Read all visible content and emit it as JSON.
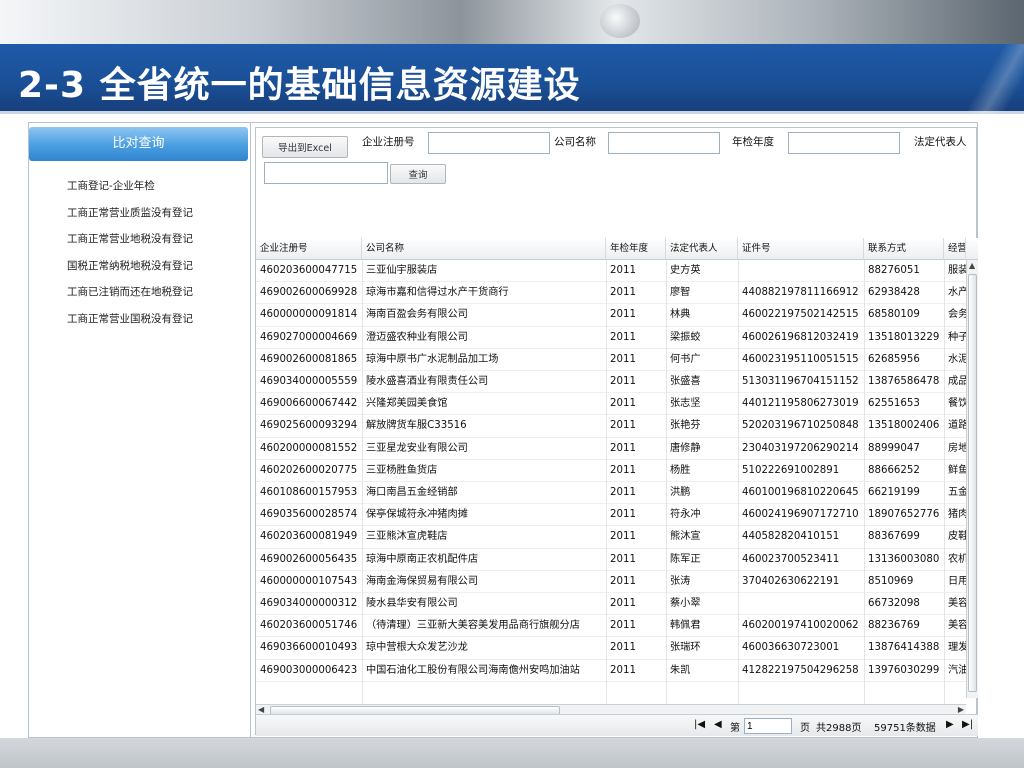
{
  "slide": {
    "title": "2-3  全省统一的基础信息资源建设"
  },
  "left_panel": {
    "header": "比对查询",
    "items": [
      "工商登记-企业年检",
      "工商正常营业质监没有登记",
      "工商正常营业地税没有登记",
      "国税正常纳税地税没有登记",
      "工商已注销而还在地税登记",
      "工商正常营业国税没有登记"
    ]
  },
  "toolbar": {
    "export_label": "导出到Excel",
    "search_label": "查询",
    "fields": {
      "reg_no": {
        "label": "企业注册号",
        "value": ""
      },
      "company": {
        "label": "公司名称",
        "value": ""
      },
      "year": {
        "label": "年检年度",
        "value": ""
      },
      "legal_rep": {
        "label": "法定代表人",
        "value": ""
      }
    }
  },
  "grid": {
    "columns": [
      "企业注册号",
      "公司名称",
      "年检年度",
      "法定代表人",
      "证件号",
      "联系方式",
      "经营"
    ],
    "rows": [
      [
        "460203600047715",
        "三亚仙宇服装店",
        "2011",
        "史方英",
        "",
        "88276051",
        "服装"
      ],
      [
        "469002600069928",
        "琼海市嘉和信得过水产干货商行",
        "2011",
        "廖智",
        "440882197811166912",
        "62938428",
        "水产"
      ],
      [
        "460000000091814",
        "海南百盈会务有限公司",
        "2011",
        "林典",
        "460022197502142515",
        "68580109",
        "会务"
      ],
      [
        "469027000004669",
        "澄迈盛农种业有限公司",
        "2011",
        "梁振蛟",
        "460026196812032419",
        "13518013229",
        "种子"
      ],
      [
        "469002600081865",
        "琼海中原书广水泥制品加工场",
        "2011",
        "何书广",
        "460023195110051515",
        "62685956",
        "水泥"
      ],
      [
        "469034000005559",
        "陵水盛喜酒业有限责任公司",
        "2011",
        "张盛喜",
        "513031196704151152",
        "13876586478",
        "成品"
      ],
      [
        "469006600067442",
        "兴隆郑美园美食馆",
        "2011",
        "张志坚",
        "440121195806273019",
        "62551653",
        "餐饮"
      ],
      [
        "469025600093294",
        "解放牌货车服C33516",
        "2011",
        "张艳芬",
        "520203196710250848",
        "13518002406",
        "道路"
      ],
      [
        "460200000081552",
        "三亚星龙安业有限公司",
        "2011",
        "唐修静",
        "230403197206290214",
        "88999047",
        "房地"
      ],
      [
        "460202600020775",
        "三亚杨胜鱼货店",
        "2011",
        "杨胜",
        "510222691002891",
        "88666252",
        "鲜鱼"
      ],
      [
        "460108600157953",
        "海口南昌五金经销部",
        "2011",
        "洪鹏",
        "460100196810220645",
        "66219199",
        "五金"
      ],
      [
        "469035600028574",
        "保亭保城符永冲猪肉摊",
        "2011",
        "符永冲",
        "460024196907172710",
        "18907652776",
        "猪肉"
      ],
      [
        "460203600081949",
        "三亚熊沐宣虎鞋店",
        "2011",
        "熊沐宣",
        "440582820410151",
        "88367699",
        "皮鞋"
      ],
      [
        "469002600056435",
        "琼海中原南正农机配件店",
        "2011",
        "陈军正",
        "460023700523411",
        "13136003080",
        "农机"
      ],
      [
        "460000000107543",
        "海南金海保贸易有限公司",
        "2011",
        "张涛",
        "370402630622191",
        "8510969",
        "日用"
      ],
      [
        "469034000000312",
        "陵水县华安有限公司",
        "2011",
        "蔡小翠",
        "",
        "66732098",
        "美容"
      ],
      [
        "460203600051746",
        "（待清理）三亚新大美容美发用品商行旗舰分店",
        "2011",
        "韩佩君",
        "460200197410020062",
        "88236769",
        "美容"
      ],
      [
        "469036600010493",
        "琼中营根大众发艺沙龙",
        "2011",
        "张瑞环",
        "460036630723001",
        "13876414388",
        "理发"
      ],
      [
        "469003000006423",
        "中国石油化工股份有限公司海南儋州安鸣加油站",
        "2011",
        "朱凯",
        "412822197504296258",
        "13976030299",
        "汽油"
      ]
    ]
  },
  "pager": {
    "page_label": "第",
    "page_value": "1",
    "page_suffix": "页",
    "total_pages": "共2988页",
    "total_records": "59751条数据"
  }
}
